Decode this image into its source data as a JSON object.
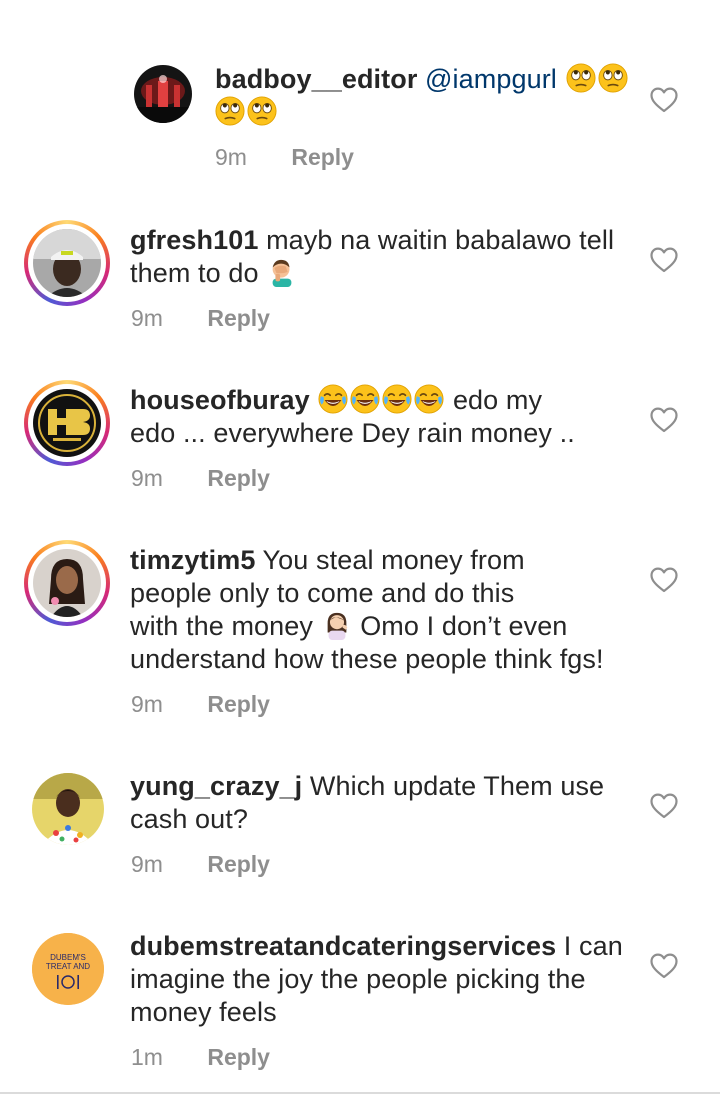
{
  "comments": [
    {
      "username": "badboy__editor",
      "mention": "@iampgurl",
      "text": "",
      "time": "9m",
      "reply": "Reply",
      "avatar": "dark-red-concert-avatar"
    },
    {
      "username": "gfresh101",
      "text_line1": " mayb na waitin babalawo tell",
      "text_line2": "them to do",
      "time": "9m",
      "reply": "Reply",
      "avatar": "man-white-cap-avatar"
    },
    {
      "username": "houseofburay",
      "text_line1_after": " edo my",
      "text_line2": "edo ... everywhere Dey rain money ..",
      "time": "9m",
      "reply": "Reply",
      "avatar": "hb-logo-avatar"
    },
    {
      "username": "timzytim5",
      "text_line1": " You steal money from",
      "text_line2": "people only to come and do this",
      "text_line3_a": "with the money",
      "text_line3_b": " Omo I don’t even",
      "text_line4": "understand how these people think fgs!",
      "time": "9m",
      "reply": "Reply",
      "avatar": "woman-selfie-avatar"
    },
    {
      "username": "yung_crazy_j",
      "text_line1": " Which update Them use",
      "text_line2": "cash out?",
      "time": "9m",
      "reply": "Reply",
      "avatar": "young-man-avatar"
    },
    {
      "username": "dubemstreatandcateringservices",
      "text_line1": " I can",
      "text_line2": "imagine the joy the people picking the",
      "text_line3": "money feels",
      "time": "1m",
      "reply": "Reply",
      "avatar": "catering-logo-avatar",
      "logo_line1": "DUBEM'S",
      "logo_line2": "TREAT AND"
    }
  ],
  "colors": {
    "text": "#262626",
    "meta": "#8e8e8e",
    "mention": "#00376b",
    "catering_orange": "#f7b24a"
  },
  "icons": {
    "like": "heart-outline-icon",
    "eye_roll": "face-with-rolling-eyes-emoji",
    "facepalm": "man-facepalming-emoji",
    "laugh": "face-with-tears-of-joy-emoji",
    "woman_tipping": "woman-tipping-hand-emoji"
  }
}
